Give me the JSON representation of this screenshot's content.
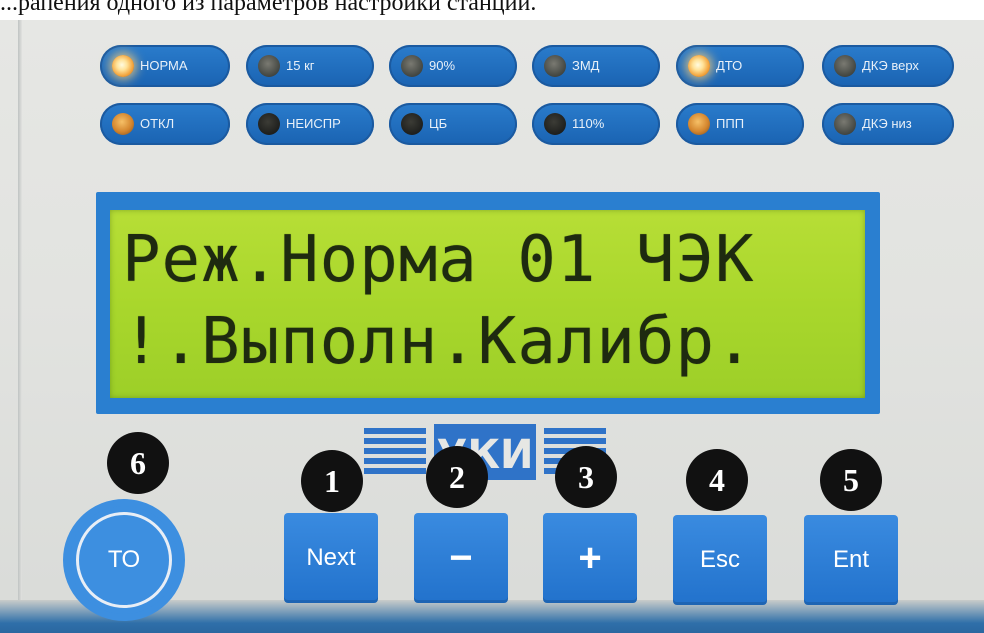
{
  "caption": "...рапения одного из параметров настройки станции.",
  "indicators": [
    {
      "label": "НОРМА",
      "lamp": "lit"
    },
    {
      "label": "15 кг",
      "lamp": "off"
    },
    {
      "label": "90%",
      "lamp": "off"
    },
    {
      "label": "ЗМД",
      "lamp": "off"
    },
    {
      "label": "ДТО",
      "lamp": "lit"
    },
    {
      "label": "ДКЭ верх",
      "lamp": "off"
    },
    {
      "label": "ОТКЛ",
      "lamp": "dim-orange"
    },
    {
      "label": "НЕИСПР",
      "lamp": "dark"
    },
    {
      "label": "ЦБ",
      "lamp": "dark"
    },
    {
      "label": "110%",
      "lamp": "dark"
    },
    {
      "label": "ППП",
      "lamp": "dim-orange"
    },
    {
      "label": "ДКЭ низ",
      "lamp": "off"
    }
  ],
  "lcd": {
    "line1": "Реж.Норма 01 ЧЭК",
    "line2": "!.Выполн.Калибр."
  },
  "logo_text": "УКИ",
  "buttons": {
    "to": "ТО",
    "next": "Next",
    "minus": "−",
    "plus": "+",
    "esc": "Esc",
    "ent": "Ent"
  },
  "badges": {
    "b1": "1",
    "b2": "2",
    "b3": "3",
    "b4": "4",
    "b5": "5",
    "b6": "6"
  },
  "colors": {
    "panel_blue": "#2272cc",
    "lcd_green": "#a9d72c",
    "lamp_lit": "#ffe39a"
  }
}
